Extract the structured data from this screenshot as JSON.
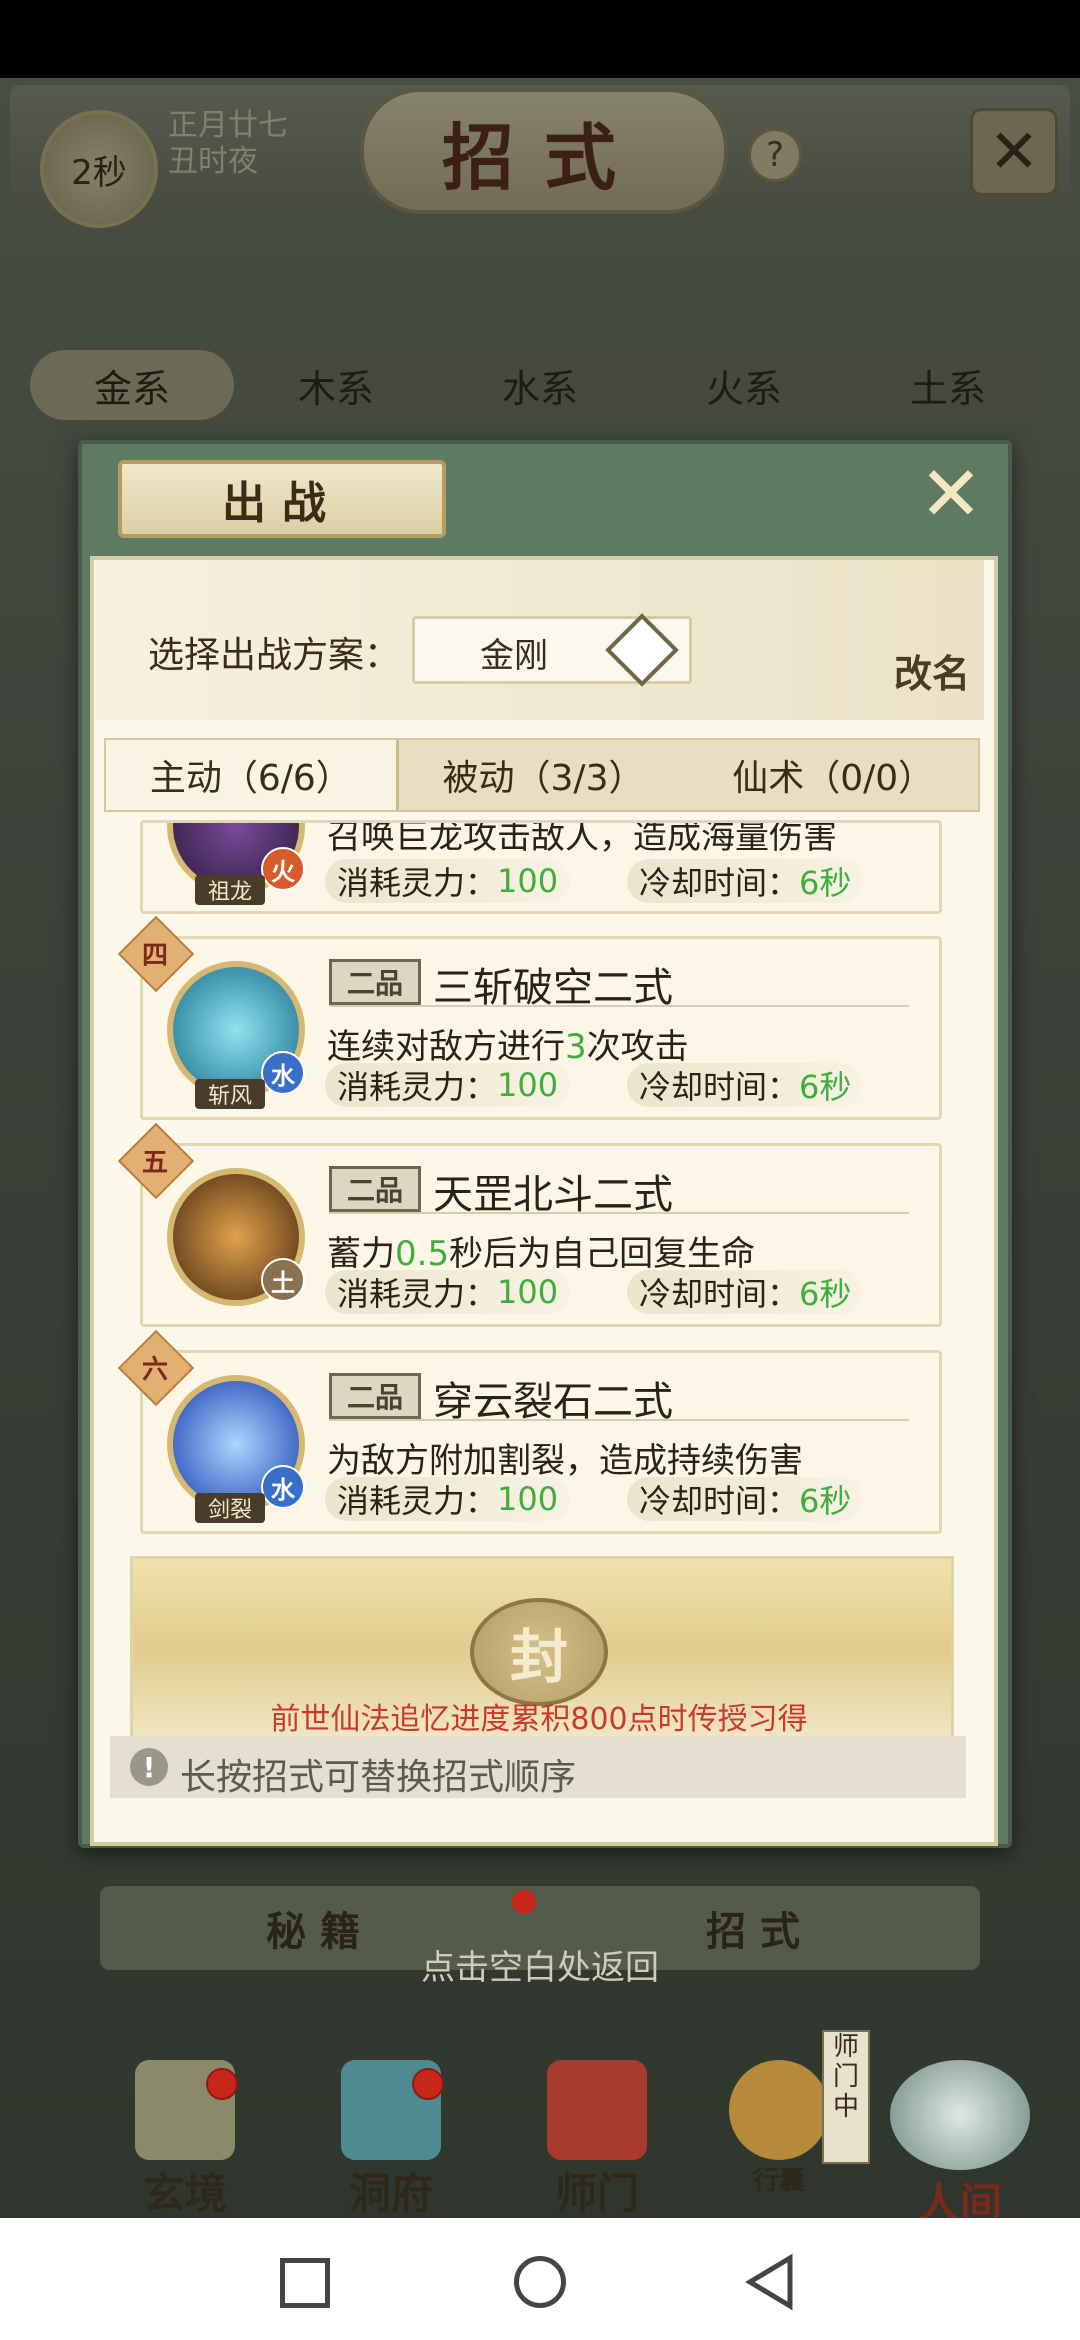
{
  "top": {
    "timer": "2秒",
    "date_line1": "正月廿七",
    "date_line2": "丑时夜",
    "title": "招式",
    "help": "?"
  },
  "element_tabs": [
    "金系",
    "木系",
    "水系",
    "火系",
    "土系"
  ],
  "dialog": {
    "header": "出战",
    "scheme_label": "选择出战方案：",
    "scheme_value": "金刚",
    "rename": "改名",
    "tabs": [
      "主动（6/6）",
      "被动（3/3）",
      "仙术（0/0）"
    ],
    "skills": [
      {
        "icon_name": "祖龙",
        "element": "火",
        "desc_partial": "召唤巨龙攻击敌人，造成海量伤害",
        "cost_label": "消耗灵力：",
        "cost": "100",
        "cd_label": "冷却时间：",
        "cd": "6秒"
      },
      {
        "grade": "四",
        "icon_name": "斩风",
        "element": "水",
        "quality": "二品",
        "name": "三斩破空二式",
        "desc_pre": "连续对敌方进行",
        "desc_num": "3",
        "desc_post": "次攻击",
        "cost_label": "消耗灵力：",
        "cost": "100",
        "cd_label": "冷却时间：",
        "cd": "6秒"
      },
      {
        "grade": "五",
        "icon_name": "",
        "element": "土",
        "quality": "二品",
        "name": "天罡北斗二式",
        "desc_pre": "蓄力",
        "desc_num": "0.5",
        "desc_post": "秒后为自己回复生命",
        "cost_label": "消耗灵力：",
        "cost": "100",
        "cd_label": "冷却时间：",
        "cd": "6秒"
      },
      {
        "grade": "六",
        "icon_name": "剑裂",
        "element": "水",
        "quality": "二品",
        "name": "穿云裂石二式",
        "desc_pre": "为敌方附加割裂，造成持续伤害",
        "desc_num": "",
        "desc_post": "",
        "cost_label": "消耗灵力：",
        "cost": "100",
        "cd_label": "冷却时间：",
        "cd": "6秒"
      }
    ],
    "seal_char": "封",
    "seal_text": "前世仙法追忆进度累积800点时传授习得",
    "tip": "长按招式可替换招式顺序"
  },
  "book_tabs": [
    "秘籍",
    "招式"
  ],
  "return_text": "点击空白处返回",
  "bottom_nav": {
    "items": [
      "玄境",
      "洞府",
      "师门",
      "行囊",
      "人间"
    ],
    "status": "师门中"
  },
  "colors": {
    "accent_green": "#3fae3c",
    "seal_red": "#c83a2a",
    "panel": "#fbf7ea"
  }
}
